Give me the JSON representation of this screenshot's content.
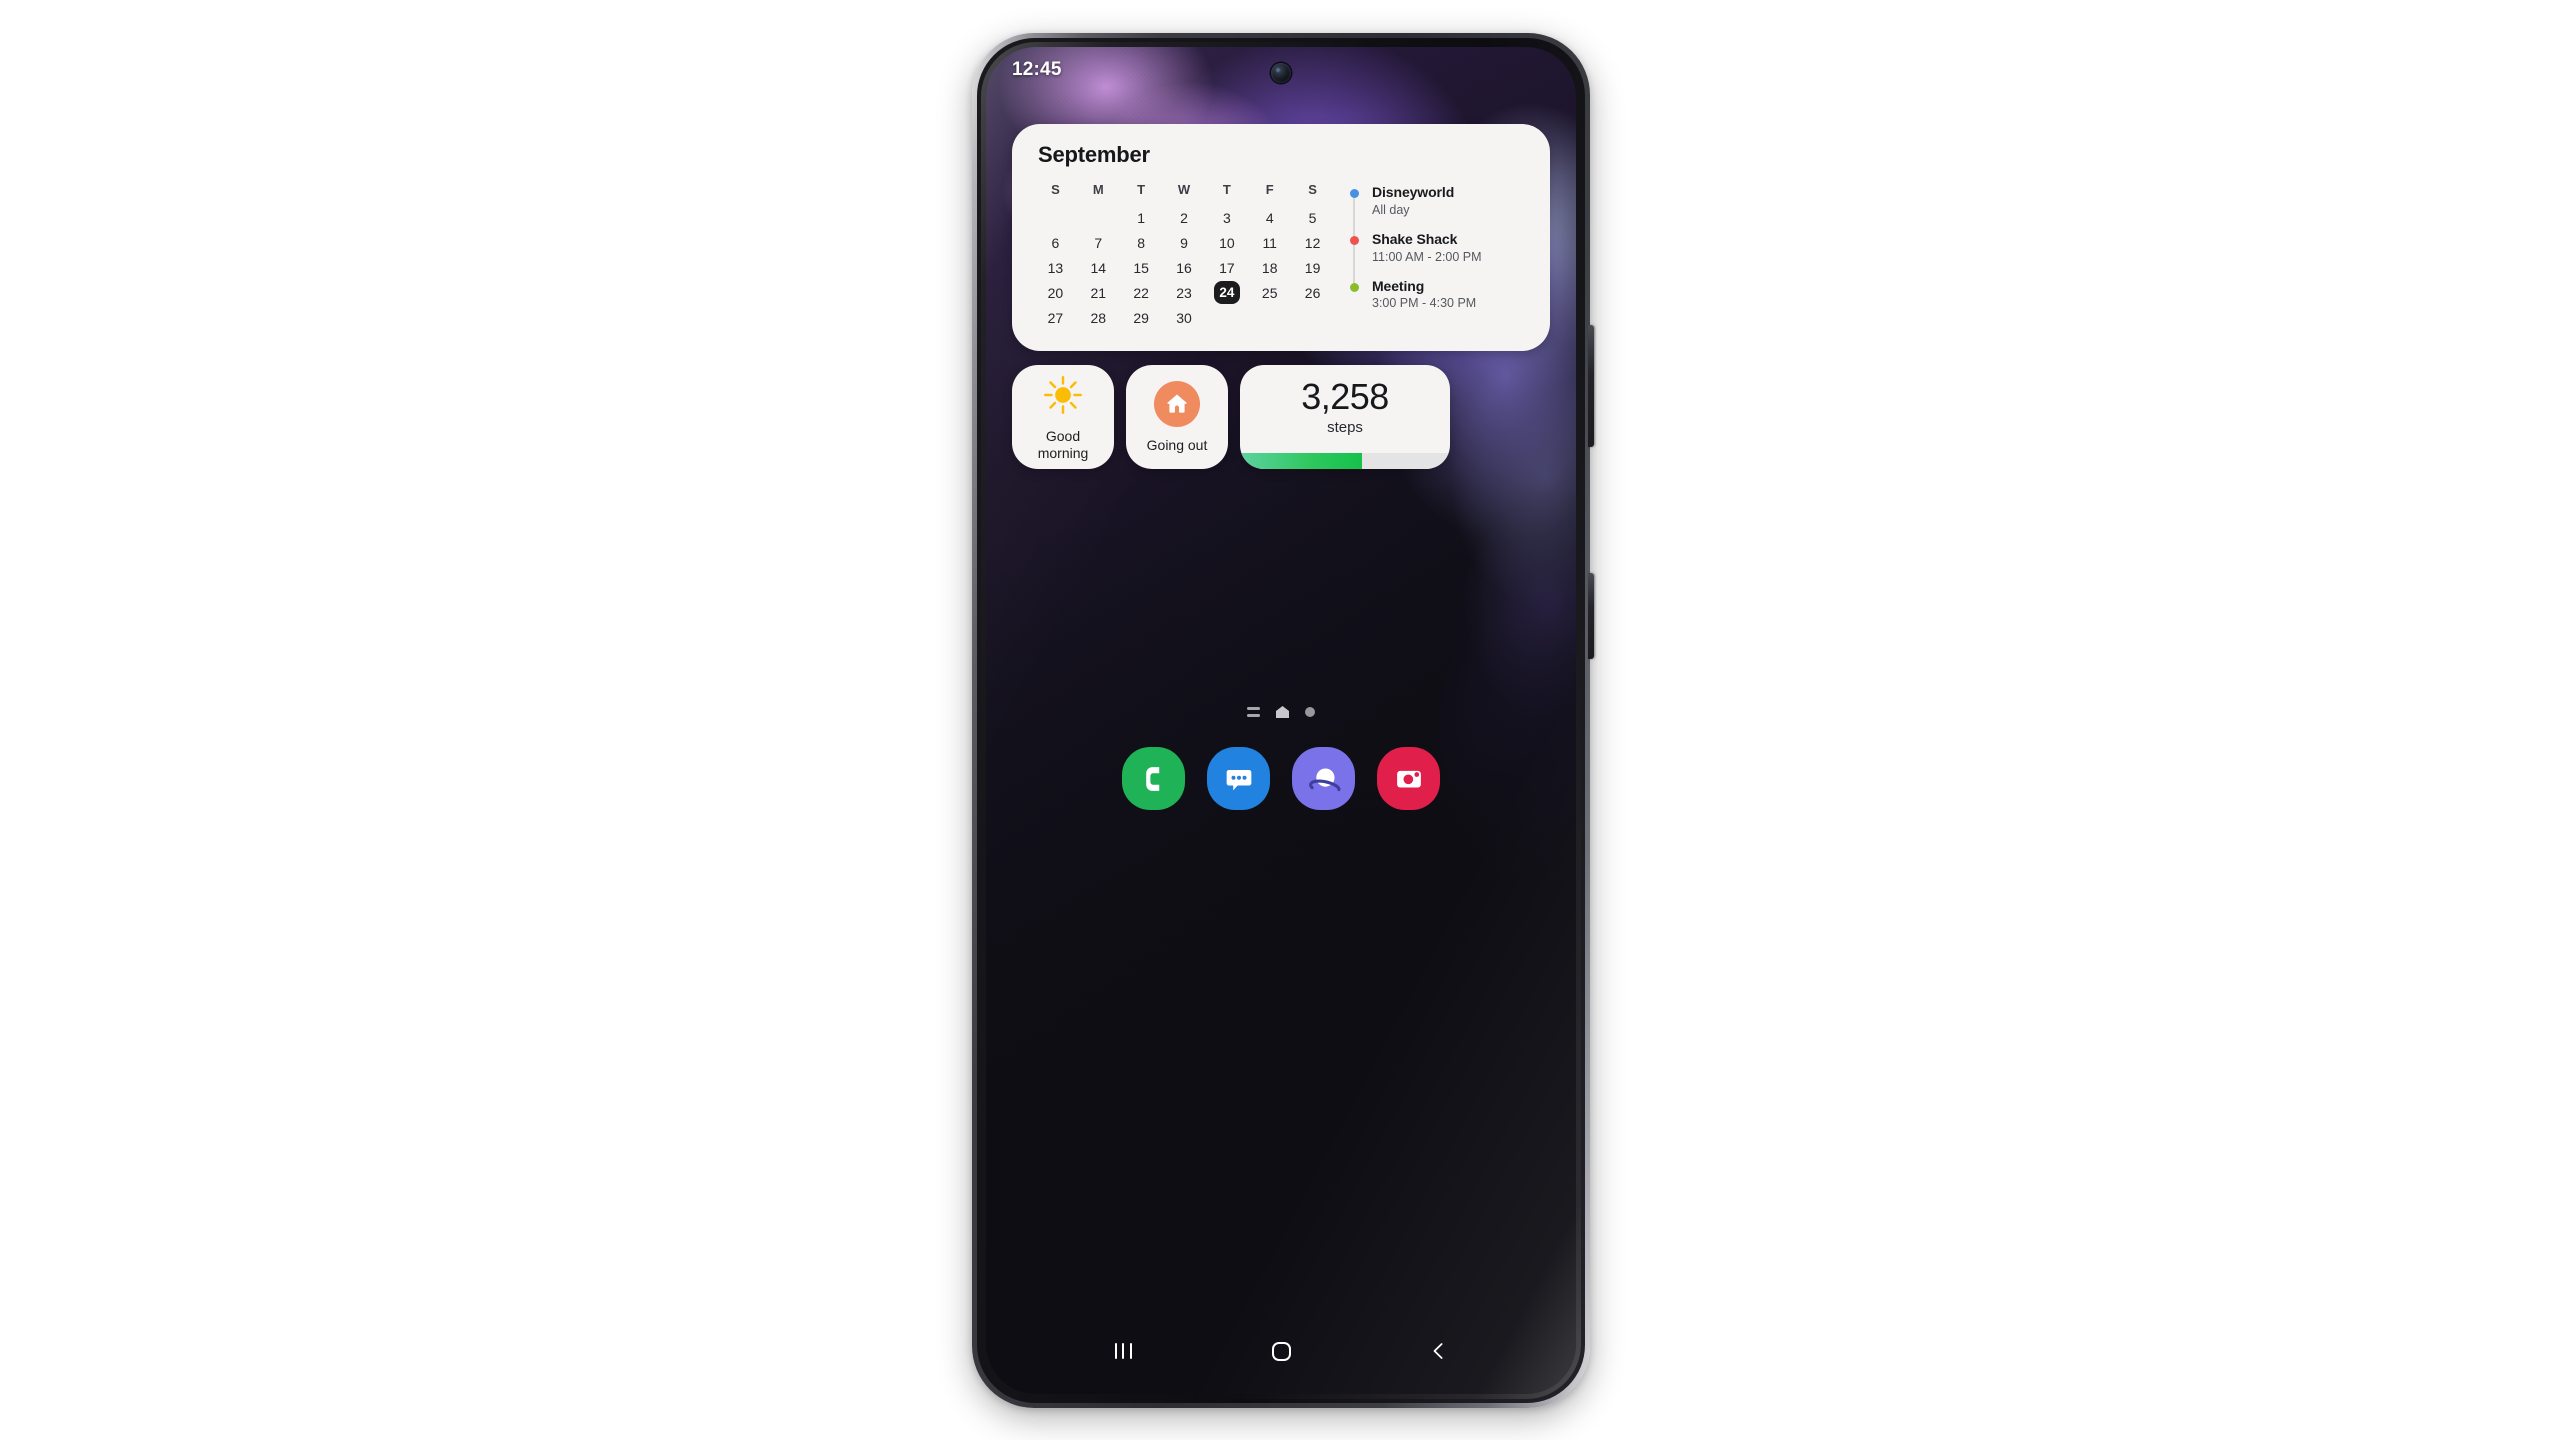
{
  "device": {
    "model_name": "Galaxy phone",
    "frame_color": "#2d2d33",
    "screen_bg": "#0e0d11"
  },
  "status_bar": {
    "time": "12:45"
  },
  "calendar_widget": {
    "month": "September",
    "weekday_headers": [
      "S",
      "M",
      "T",
      "W",
      "T",
      "F",
      "S"
    ],
    "weeks": [
      [
        "",
        "",
        "1",
        "2",
        "3",
        "4",
        "5"
      ],
      [
        "6",
        "7",
        "8",
        "9",
        "10",
        "11",
        "12"
      ],
      [
        "13",
        "14",
        "15",
        "16",
        "17",
        "18",
        "19"
      ],
      [
        "20",
        "21",
        "22",
        "23",
        "24",
        "25",
        "26"
      ],
      [
        "27",
        "28",
        "29",
        "30",
        "",
        "",
        ""
      ]
    ],
    "selected_day": "24",
    "events": [
      {
        "title": "Disneyworld",
        "time": "All day",
        "dot_color": "#4a90e2"
      },
      {
        "title": "Shake Shack",
        "time": "11:00 AM - 2:00 PM",
        "dot_color": "#ef5350"
      },
      {
        "title": "Meeting",
        "time": "3:00 PM - 4:30 PM",
        "dot_color": "#8bbd2a"
      }
    ]
  },
  "routine_widgets": [
    {
      "label": "Good\nmorning",
      "label_line1": "Good",
      "label_line2": "morning",
      "icon": "sun-icon",
      "icon_color": "#fbbc05"
    },
    {
      "label": "Going out",
      "icon": "house-icon",
      "icon_bg_color": "#f08a5f"
    }
  ],
  "steps_widget": {
    "count": "3,258",
    "unit": "steps",
    "progress_percent": 58,
    "fill_color": "#2fc75f",
    "track_color": "#e4e4e4"
  },
  "page_indicator": {
    "pages": [
      {
        "icon": "lines-icon",
        "active": false
      },
      {
        "icon": "home-icon",
        "active": true
      },
      {
        "icon": "dot-icon",
        "active": false
      }
    ]
  },
  "dock": {
    "apps": [
      {
        "name": "Phone",
        "icon": "phone-icon",
        "color": "#1fb256"
      },
      {
        "name": "Messages",
        "icon": "message-icon",
        "color": "#2182df"
      },
      {
        "name": "Internet",
        "icon": "browser-icon",
        "color": "#7a72e8"
      },
      {
        "name": "Camera",
        "icon": "camera-icon",
        "color": "#e01f4b"
      }
    ]
  },
  "nav_bar": {
    "recents_label": "Recents",
    "home_label": "Home",
    "back_label": "Back"
  }
}
